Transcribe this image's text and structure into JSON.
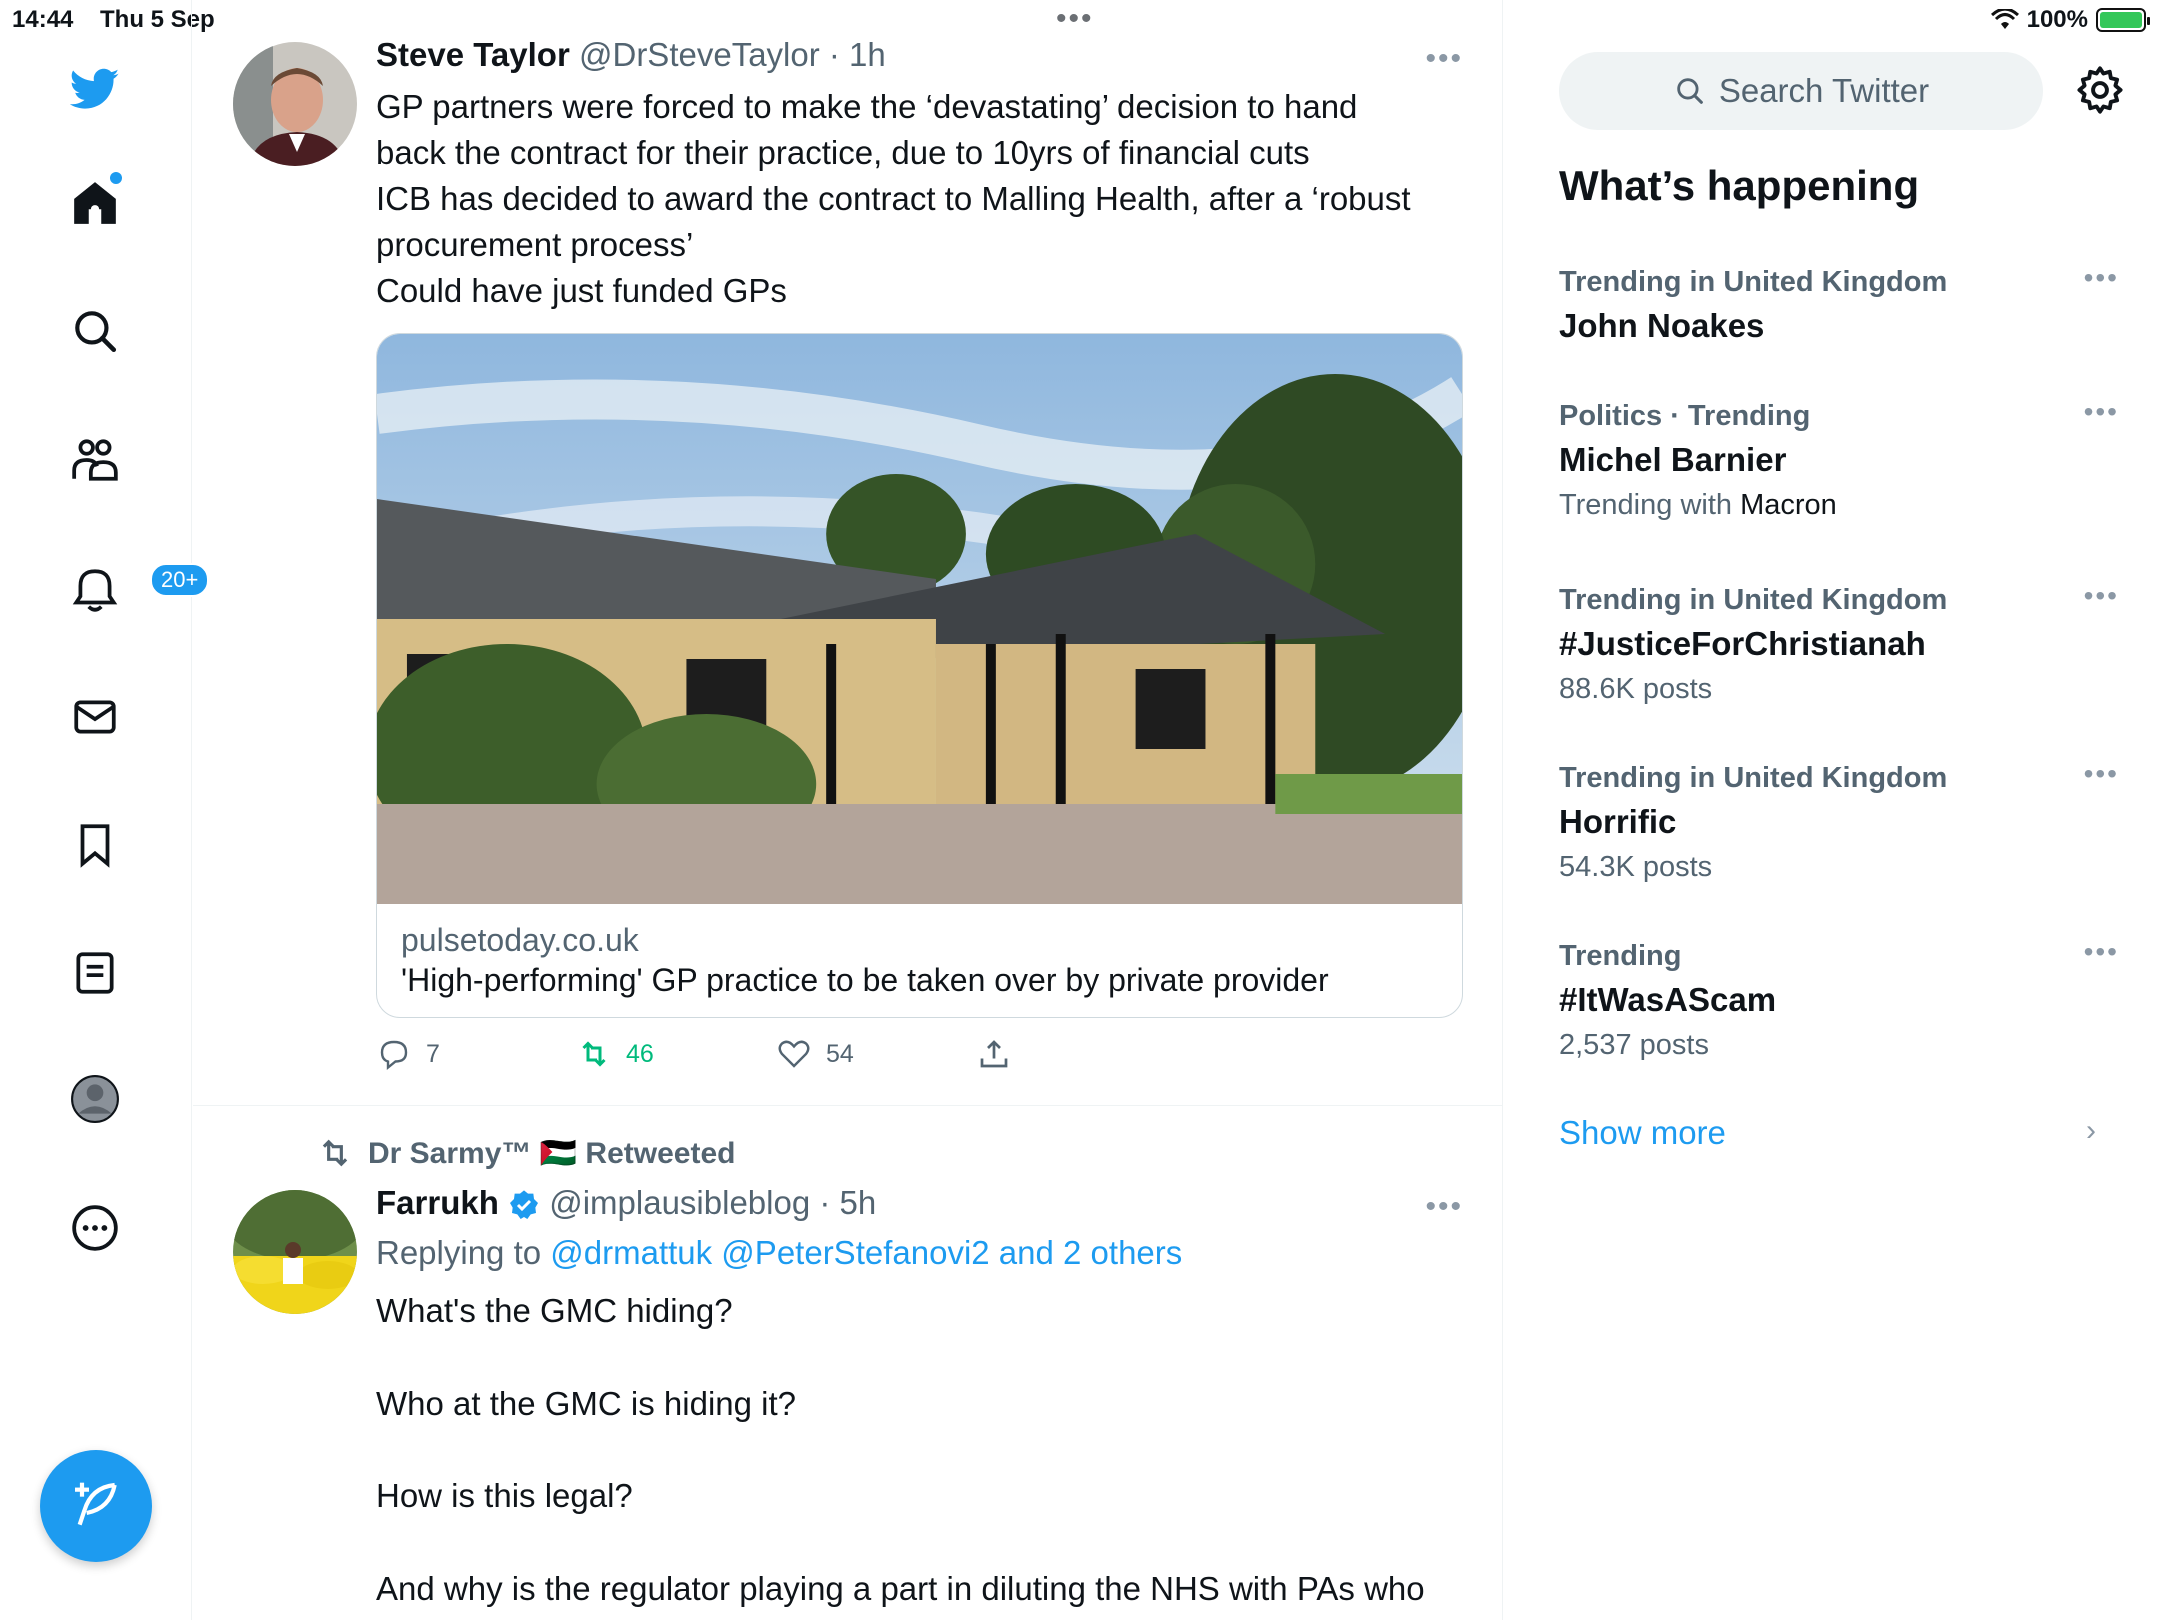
{
  "status_bar": {
    "time": "14:44",
    "date": "Thu 5 Sep",
    "battery": "100%"
  },
  "sidebar": {
    "notifications_badge": "20+",
    "items": [
      "twitter-logo",
      "home",
      "explore",
      "communities",
      "notifications",
      "messages",
      "bookmarks",
      "lists",
      "profile",
      "more"
    ]
  },
  "tweets": [
    {
      "name": "Steve Taylor",
      "handle": "@DrSteveTaylor · 1h",
      "text_lines": [
        "GP partners were forced to make the ‘devastating’ decision to hand",
        "back the contract for their practice, due to 10yrs of financial cuts",
        "ICB has decided to award the contract to Malling Health, after a ‘robust",
        "procurement process’",
        "Could have just funded GPs"
      ],
      "card": {
        "domain": "pulsetoday.co.uk",
        "title": "'High-performing' GP practice to be taken over by private provider"
      },
      "replies": "7",
      "retweets": "46",
      "likes": "54"
    },
    {
      "retweeted_by": "Dr Sarmy™ 🇵🇸 Retweeted",
      "name": "Farrukh",
      "handle": "@implausibleblog · 5h",
      "replying_prefix": "Replying to ",
      "replying_to": "@drmattuk @PeterStefanovi2 and 2 others",
      "text_lines": [
        "What's the GMC hiding?",
        "",
        "Who at the GMC is hiding it?",
        "",
        "How is this legal?",
        "",
        "And why is the regulator playing a part in diluting the NHS with PAs who"
      ]
    }
  ],
  "right_column": {
    "search_placeholder": "Search Twitter",
    "section_title": "What’s happening",
    "trends": [
      {
        "context": "Trending in United Kingdom",
        "title": "John Noakes",
        "meta": ""
      },
      {
        "context": "Politics · Trending",
        "title": "Michel Barnier",
        "meta_prefix": "Trending with ",
        "meta_bold": "Macron"
      },
      {
        "context": "Trending in United Kingdom",
        "title": "#JusticeForChristianah",
        "meta": "88.6K posts"
      },
      {
        "context": "Trending in United Kingdom",
        "title": "Horrific",
        "meta": "54.3K posts"
      },
      {
        "context": "Trending",
        "title": "#ItWasAScam",
        "meta": "2,537 posts"
      }
    ],
    "show_more": "Show more"
  },
  "colors": {
    "accent": "#1d9bf0",
    "retweet_green": "#00ba7c",
    "secondary_text": "#536471"
  }
}
